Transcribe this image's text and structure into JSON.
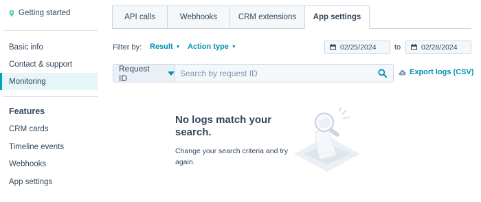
{
  "sidebar": {
    "getting_started": "Getting started",
    "items": [
      {
        "label": "Basic info"
      },
      {
        "label": "Contact & support"
      },
      {
        "label": "Monitoring"
      }
    ],
    "features_heading": "Features",
    "features": [
      {
        "label": "CRM cards"
      },
      {
        "label": "Timeline events"
      },
      {
        "label": "Webhooks"
      },
      {
        "label": "App settings"
      }
    ]
  },
  "tabs": [
    {
      "label": "API calls"
    },
    {
      "label": "Webhooks"
    },
    {
      "label": "CRM extensions"
    },
    {
      "label": "App settings"
    }
  ],
  "active_tab": "App settings",
  "filters": {
    "label": "Filter by:",
    "result": "Result",
    "action_type": "Action type",
    "date_from": "02/25/2024",
    "to_label": "to",
    "date_to": "02/28/2024"
  },
  "search": {
    "select_value": "Request ID",
    "placeholder": "Search by request ID",
    "value": ""
  },
  "export_label": "Export logs (CSV)",
  "empty_state": {
    "title": "No logs match your search.",
    "text": "Change your search criteria and try again."
  },
  "colors": {
    "accent": "#0091ae",
    "active_bg": "#e5f5f8",
    "active_border": "#00a4bd",
    "text": "#33475b"
  },
  "icons": {
    "getting_started": "location-pin-icon",
    "date": "calendar-icon",
    "search": "search-icon",
    "export": "cloud-upload-icon",
    "empty": "magnifier-illustration"
  }
}
